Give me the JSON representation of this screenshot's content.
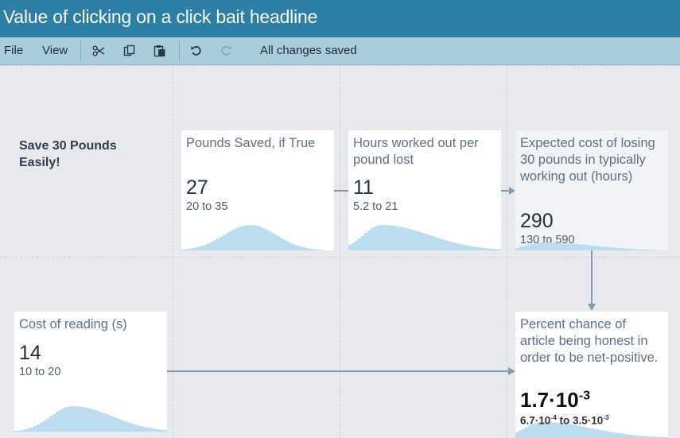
{
  "window": {
    "title": "Value of clicking on a click bait headline"
  },
  "toolbar": {
    "file_label": "File",
    "view_label": "View",
    "status": "All changes saved",
    "icons": [
      "scissors-icon",
      "copy-icon",
      "paste-icon",
      "undo-icon",
      "redo-icon"
    ]
  },
  "canvas": {
    "label": "Save 30 Pounds Easily!",
    "nodes": [
      {
        "title": "Pounds Saved, if True",
        "value": "27",
        "range": "20 to 35"
      },
      {
        "title": "Hours worked out per pound lost",
        "value": "11",
        "range": "5.2 to 21"
      },
      {
        "title": "Expected cost of losing 30 pounds in typically working out (hours)",
        "value": "290",
        "range": "130 to 590"
      },
      {
        "title": "Cost of reading (s)",
        "value": "14",
        "range": "10 to 20"
      },
      {
        "title": "Percent chance of article being honest in order to be net-positive.",
        "value_mantissa": "1.7·10",
        "value_exp": "-3",
        "range_low_mantissa": "6.7·10",
        "range_low_exp": "-4",
        "range_sep": " to ",
        "range_high_mantissa": "3.5·10",
        "range_high_exp": "-3"
      }
    ]
  },
  "colors": {
    "titlebar": "#2d7fa6",
    "toolbar": "#a9cdda",
    "canvas": "#e8e9ec",
    "distribution": "#bcdcef",
    "arrow": "#7f9db1"
  }
}
